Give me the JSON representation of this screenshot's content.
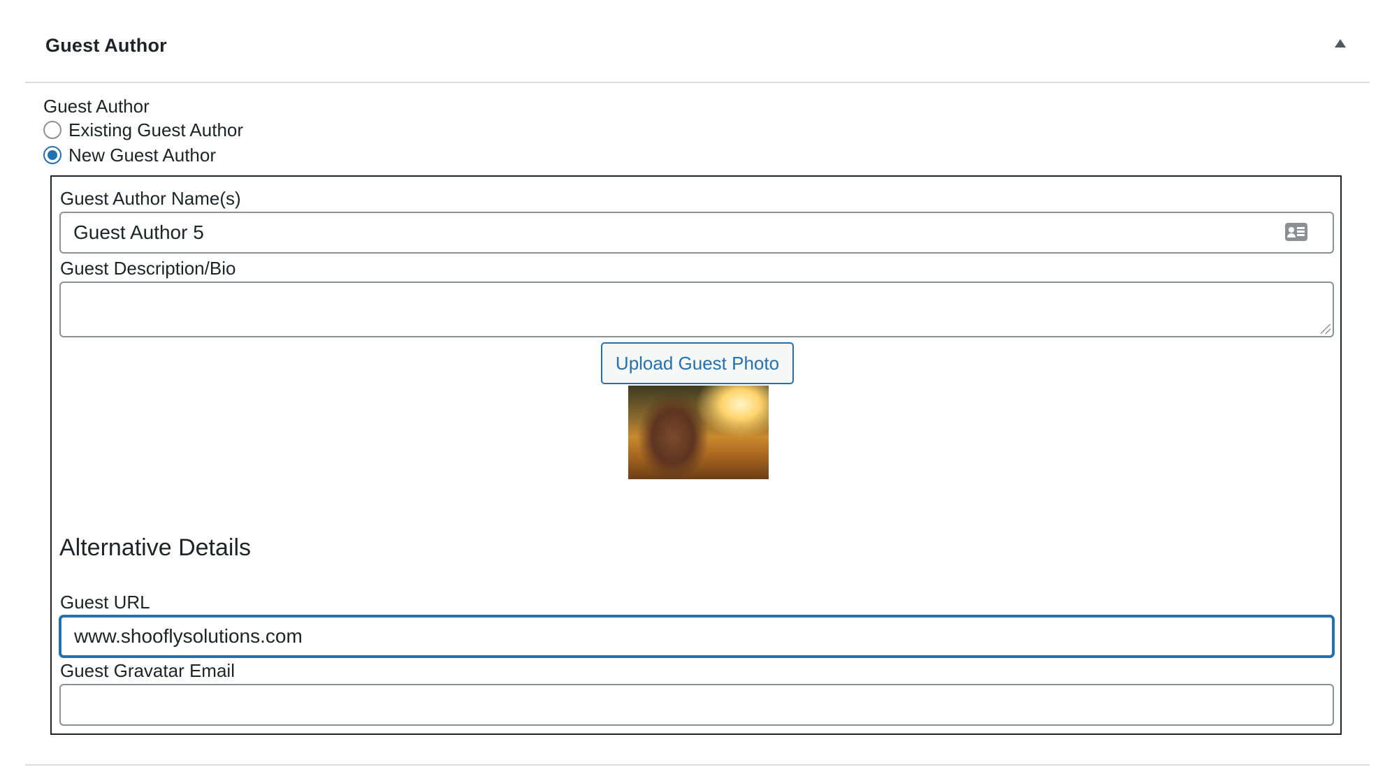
{
  "metabox": {
    "title": "Guest Author",
    "toggle_icon": "triangle-up-icon"
  },
  "guest_author": {
    "label": "Guest Author",
    "options": [
      {
        "label": "Existing Guest Author",
        "selected": false
      },
      {
        "label": "New Guest Author",
        "selected": true
      }
    ]
  },
  "new_author": {
    "name_label": "Guest Author Name(s)",
    "name_value": "Guest Author 5",
    "name_icon": "contact-card-icon",
    "bio_label": "Guest Description/Bio",
    "bio_value": "",
    "upload_button": "Upload Guest Photo",
    "alt_heading": "Alternative Details",
    "url_label": "Guest URL",
    "url_value": "www.shooflysolutions.com",
    "email_label": "Guest Gravatar Email",
    "email_value": ""
  },
  "colors": {
    "accent": "#2271b1",
    "border": "#8c8f94",
    "text": "#1d2327"
  }
}
